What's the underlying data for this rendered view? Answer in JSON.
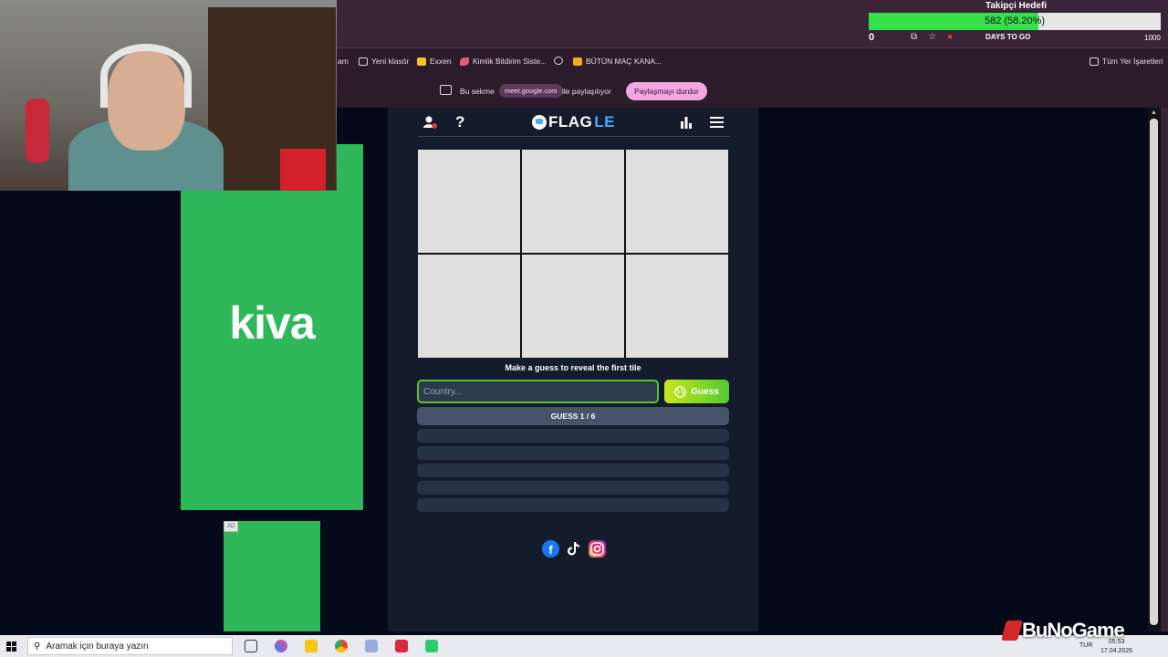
{
  "follower_goal": {
    "title": "Takipçi Hedefi",
    "progress_text": "582 (58.20%)",
    "progress_fraction": 0.582,
    "current": "0",
    "target": "1000",
    "overlay_text": "DAYS TO GO"
  },
  "bookmarks": [
    {
      "label": "am",
      "icon": "truncated"
    },
    {
      "label": "Yeni klasör",
      "icon": "folder-icon"
    },
    {
      "label": "Exxen",
      "icon": "exxen-icon"
    },
    {
      "label": "Kimlik Bildirim Siste...",
      "icon": "feather-icon"
    },
    {
      "label": "",
      "icon": "globe-icon"
    },
    {
      "label": "BÜTÜN MAÇ KANA...",
      "icon": "jp-icon"
    },
    {
      "label": "Tüm Yer İşaretleri",
      "icon": "folder-icon"
    }
  ],
  "share_bar": {
    "text_before": "Bu sekme",
    "url": "meet.google.com",
    "text_after": "ile paylaşılıyor",
    "stop_button": "Paylaşmayı durdur"
  },
  "ad": {
    "logo": "kiva",
    "badge": "AD"
  },
  "game": {
    "logo_main": "FLAG",
    "logo_accent": "LE",
    "hint": "Make a guess to reveal the first tile",
    "input_placeholder": "Country...",
    "guess_button": "Guess",
    "guess_counter": "GUESS 1 / 6",
    "tiles": 6,
    "empty_guess_slots": 5
  },
  "taskbar": {
    "search_placeholder": "Aramak için buraya yazın",
    "lang": "TUR",
    "time": "05:53",
    "date": "17.04.2026"
  },
  "watermark": "BuNoGame",
  "colors": {
    "game_bg": "#141c2c",
    "accent_green": "#59c234",
    "ad_green": "#2fb85a",
    "browser_chrome": "#3a2438"
  }
}
